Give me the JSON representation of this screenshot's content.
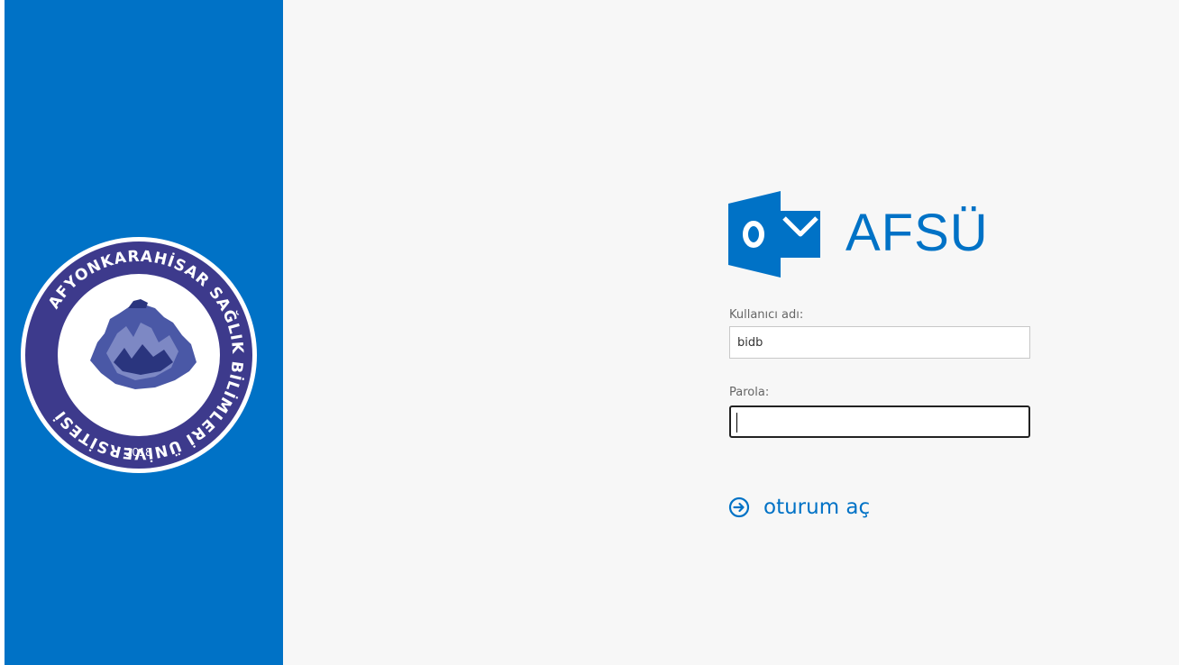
{
  "side_panel": {
    "accent_color": "#0072c6",
    "seal": {
      "ring_text": "AFYONKARAHİSAR SAĞLIK BİLİMLERİ ÜNİVERSİTESİ",
      "year": "2018",
      "colors": {
        "ring": "#3d3a8c",
        "crescent": "#d62031",
        "mountain": "#2f3e8f"
      }
    }
  },
  "brand": {
    "logo_icon": "outlook-icon",
    "logo_letter": "o",
    "name": "AFSÜ",
    "color": "#0072c6"
  },
  "form": {
    "username": {
      "label": "Kullanıcı adı:",
      "value": "bidb"
    },
    "password": {
      "label": "Parola:",
      "value": ""
    },
    "submit": {
      "icon": "arrow-circle-right-icon",
      "label": "oturum aç"
    }
  }
}
